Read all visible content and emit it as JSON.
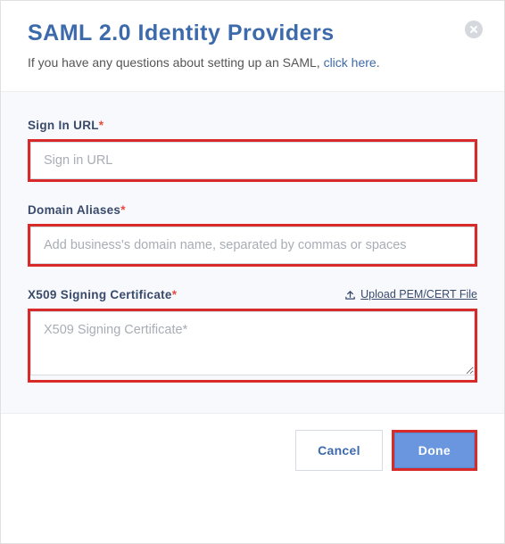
{
  "header": {
    "title": "SAML 2.0 Identity Providers",
    "subtitle_prefix": "If you have any questions about setting up an SAML, ",
    "subtitle_link": "click here",
    "subtitle_suffix": "."
  },
  "form": {
    "signin": {
      "label": "Sign In URL",
      "placeholder": "Sign in URL",
      "value": ""
    },
    "domain": {
      "label": "Domain Aliases",
      "placeholder": "Add business's domain name, separated by commas or spaces",
      "value": ""
    },
    "cert": {
      "label": "X509 Signing Certificate",
      "placeholder": "X509 Signing Certificate*",
      "value": "",
      "upload_label": "Upload PEM/CERT File"
    }
  },
  "footer": {
    "cancel": "Cancel",
    "done": "Done"
  }
}
